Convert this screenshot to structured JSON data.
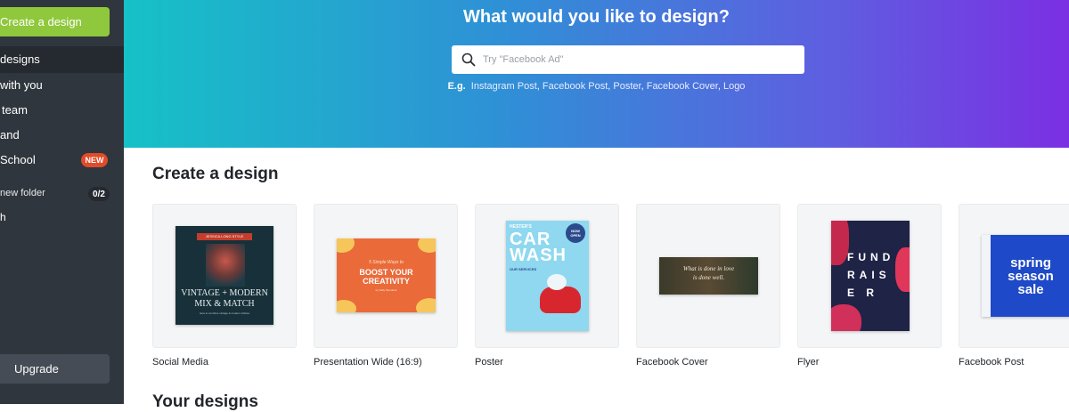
{
  "sidebar": {
    "create_label": "Create a design",
    "items": [
      {
        "label": "designs"
      },
      {
        "label": "with you"
      },
      {
        "label": "team"
      },
      {
        "label": "and"
      },
      {
        "label": "School"
      }
    ],
    "new_badge": "NEW",
    "folder_label": "new folder",
    "folder_count": "0/2",
    "trash_label": "h",
    "upgrade_label": "Upgrade"
  },
  "hero": {
    "title": "What would you like to design?",
    "search_placeholder": "Try \"Facebook Ad\"",
    "eg_label": "E.g.",
    "suggestions": [
      "Instagram Post",
      "Facebook Post",
      "Poster",
      "Facebook Cover",
      "Logo"
    ],
    "gradient_colors": [
      "#16c1c7",
      "#7b2fe3"
    ]
  },
  "create_section": {
    "title": "Create a design",
    "cards": [
      {
        "label": "Social Media",
        "thumb": {
          "line1": "JESSICA LONG STYLE",
          "line2": "VINTAGE + MODERN",
          "line3": "MIX & MATCH",
          "line4": "How to combine vintage & modern clothes"
        }
      },
      {
        "label": "Presentation Wide (16:9)",
        "thumb": {
          "line1": "5 Simple Ways to",
          "line2": "BOOST YOUR",
          "line3": "CREATIVITY",
          "line4": "by Sally Mendoza"
        }
      },
      {
        "label": "Poster",
        "thumb": {
          "line1": "HESTER'S",
          "line2": "CAR",
          "line3": "WASH",
          "badge": "NOW OPEN",
          "line4": "OUR SERVICES"
        }
      },
      {
        "label": "Facebook Cover",
        "thumb": {
          "line1": "What is done in love",
          "line2": "is done well."
        }
      },
      {
        "label": "Flyer",
        "thumb": {
          "line1": "FUND",
          "line2": "RAIS",
          "line3": "E R"
        }
      },
      {
        "label": "Facebook Post",
        "thumb": {
          "line1": "spring",
          "line2": "season",
          "line3": "sale"
        }
      }
    ]
  },
  "your_designs": {
    "title": "Your designs"
  }
}
